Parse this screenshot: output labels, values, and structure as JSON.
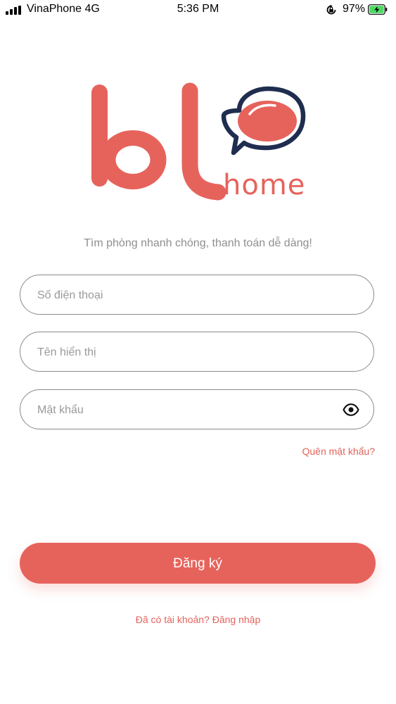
{
  "status_bar": {
    "carrier": "VinaPhone",
    "network": "4G",
    "time": "5:36 PM",
    "battery": "97%"
  },
  "logo": {
    "mark": "bl",
    "word": "home",
    "brand_color": "#e6635c",
    "outline_color": "#1f2d4f"
  },
  "tagline": "Tìm phòng nhanh chóng, thanh toán dễ dàng!",
  "form": {
    "phone_placeholder": "Số điện thoại",
    "display_name_placeholder": "Tên hiển thị",
    "password_placeholder": "Mật khẩu",
    "show_password_icon": "eye-icon"
  },
  "forgot_password": "Quên mật khẩu?",
  "register_button": "Đăng ký",
  "login_link": "Đã có tài khoản? Đăng nhập"
}
